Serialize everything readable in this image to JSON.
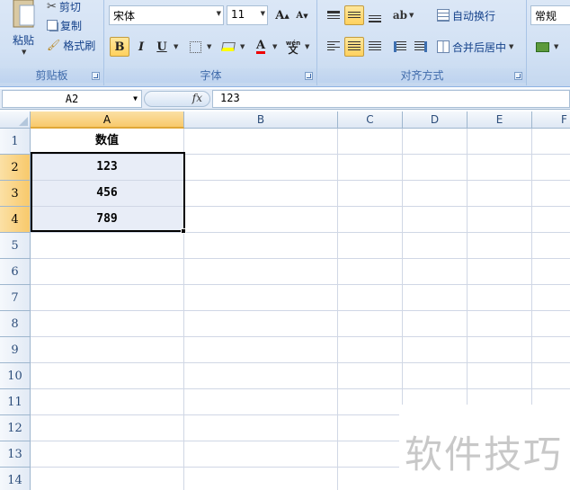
{
  "ribbon": {
    "clipboard": {
      "paste_label": "粘贴",
      "cut_label": "剪切",
      "copy_label": "复制",
      "format_painter_label": "格式刷",
      "group_label": "剪贴板"
    },
    "font": {
      "font_name": "宋体",
      "font_size": "11",
      "bold": "B",
      "italic": "I",
      "underline": "U",
      "font_color_label": "A",
      "phonetic_label": "wén",
      "group_label": "字体"
    },
    "alignment": {
      "wrap_text_label": "自动换行",
      "merge_center_label": "合并后居中",
      "group_label": "对齐方式"
    },
    "number": {
      "format_value": "常规"
    }
  },
  "formula_bar": {
    "name_box": "A2",
    "fx_label": "fx",
    "formula_value": "123"
  },
  "sheet": {
    "columns": [
      "A",
      "B",
      "C",
      "D",
      "E",
      "F"
    ],
    "rows": [
      "1",
      "2",
      "3",
      "4",
      "5",
      "6",
      "7",
      "8",
      "9",
      "10",
      "11",
      "12",
      "13",
      "14"
    ],
    "cells": {
      "A1": "数值",
      "A2": "123",
      "A3": "456",
      "A4": "789"
    }
  },
  "watermark": {
    "text": "软件技巧"
  },
  "colors": {
    "accent": "#15428b",
    "selection_header": "#f8c96b",
    "range_fill": "#e8edf7",
    "ribbon_bg": "#d2e1f4"
  }
}
